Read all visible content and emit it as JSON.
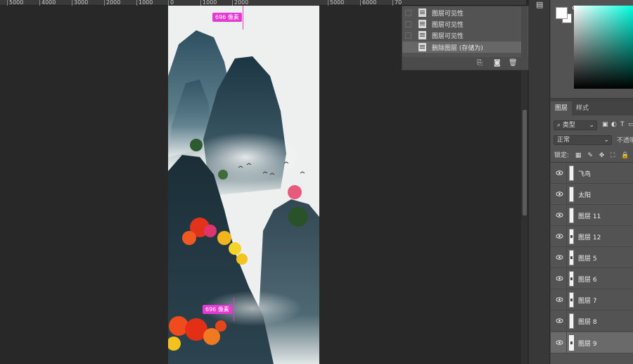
{
  "ruler": {
    "ticks": [
      "5000",
      "4000",
      "3000",
      "2000",
      "1000",
      "0",
      "1000",
      "2000",
      "5000",
      "6000",
      "70"
    ]
  },
  "canvas": {
    "measure_top": "696 像素",
    "measure_bottom": "696 像素"
  },
  "history": {
    "items": [
      {
        "label": "图层可见性"
      },
      {
        "label": "图层可见性"
      },
      {
        "label": "图层可见性"
      },
      {
        "label": "删除图层 (存储为)"
      }
    ]
  },
  "layers_panel": {
    "tabs": [
      "图层",
      "样式"
    ],
    "filter": "类型",
    "blend_mode": "正常",
    "opacity_label": "不透明",
    "lock_label": "锁定:",
    "layers": [
      {
        "name": "飞鸟"
      },
      {
        "name": "太阳"
      },
      {
        "name": "图层 11"
      },
      {
        "name": "图层 12"
      },
      {
        "name": "图层 5"
      },
      {
        "name": "图层 6"
      },
      {
        "name": "图层 7"
      },
      {
        "name": "图层 8"
      },
      {
        "name": "图层 9"
      }
    ]
  },
  "colors": {
    "accent_magenta": "#e43ad3",
    "panel_bg": "#535353",
    "workspace_bg": "#282828"
  }
}
